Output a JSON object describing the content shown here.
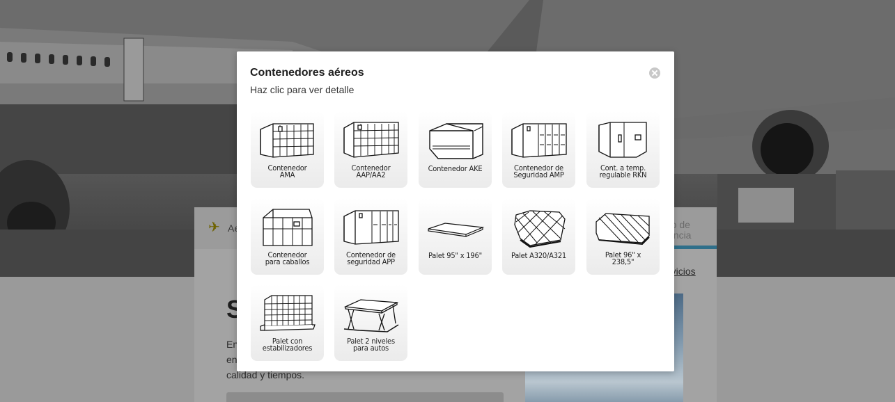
{
  "background": {
    "tab_partial": "Ae",
    "tab_right": "ro de\nancia",
    "servicios_link": "rvicios",
    "heading_partial": "S",
    "paragraph": "En\nen\ncalidad y tiempos."
  },
  "modal": {
    "title": "Contenedores aéreos",
    "subtitle": "Haz clic para ver detalle",
    "close_icon": "close-icon",
    "items": [
      {
        "label": "Contenedor\nAMA",
        "icon": "container-ama-icon"
      },
      {
        "label": "Contenedor\nAAP/AA2",
        "icon": "container-aap-icon"
      },
      {
        "label": "Contenedor AKE",
        "icon": "container-ake-icon"
      },
      {
        "label": "Contenedor de\nSeguridad AMP",
        "icon": "container-amp-icon"
      },
      {
        "label": "Cont. a temp.\nregulable RKN",
        "icon": "container-rkn-icon"
      },
      {
        "label": "Contenedor\npara caballos",
        "icon": "horse-container-icon"
      },
      {
        "label": "Contenedor de\nseguridad APP",
        "icon": "container-app-icon"
      },
      {
        "label": "Palet 95\" x 196\"",
        "icon": "pallet-flat-icon"
      },
      {
        "label": "Palet A320/A321",
        "icon": "pallet-a320-icon"
      },
      {
        "label": "Palet 96\" x\n238,5\"",
        "icon": "pallet-96-icon"
      },
      {
        "label": "Palet con\nestabilizadores",
        "icon": "pallet-stabilizers-icon"
      },
      {
        "label": "Palet 2 niveles\npara autos",
        "icon": "pallet-car-rack-icon"
      }
    ]
  }
}
